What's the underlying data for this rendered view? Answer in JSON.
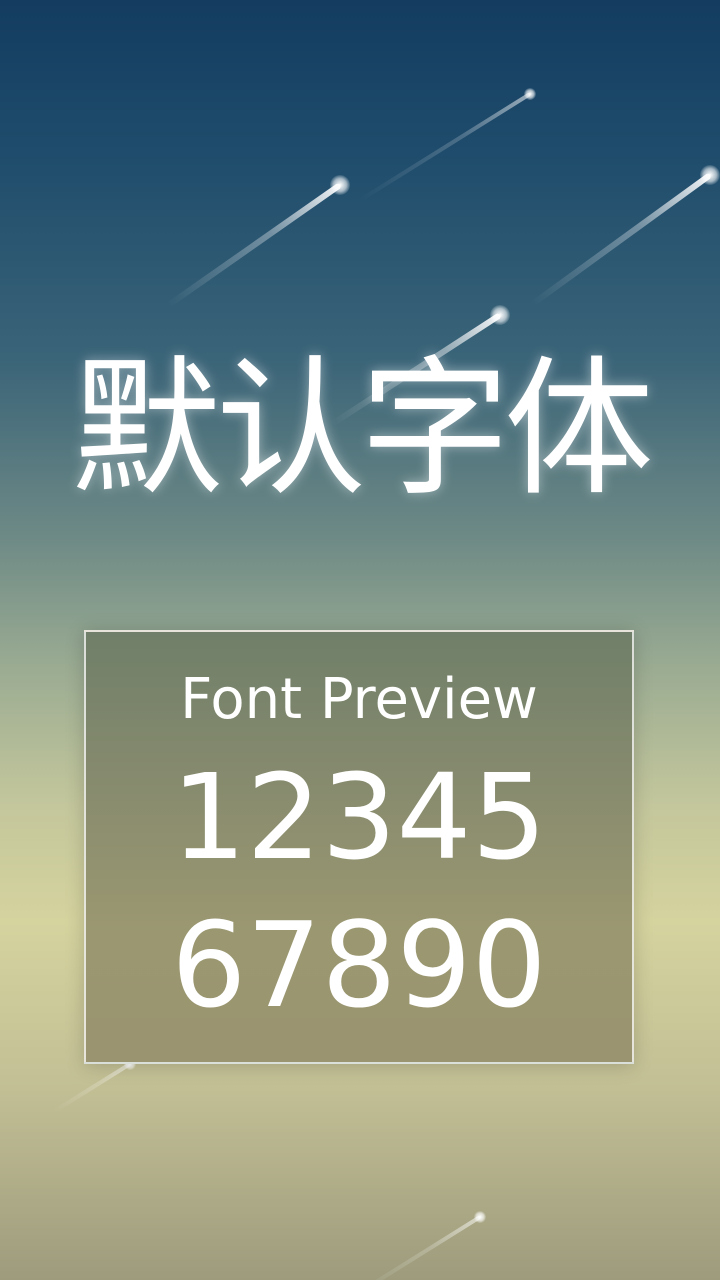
{
  "screen": {
    "title": "默认字体"
  },
  "preview": {
    "label": "Font Preview",
    "digits_line_1": "12345",
    "digits_line_2": "67890"
  },
  "colors": {
    "sky_top": "#133c60",
    "sky_mid": "#6e8a86",
    "sky_low": "#d5d39e",
    "text": "#ffffff",
    "card_border": "#ffffff"
  },
  "decor": {
    "background": "meteor-shower-sky"
  }
}
